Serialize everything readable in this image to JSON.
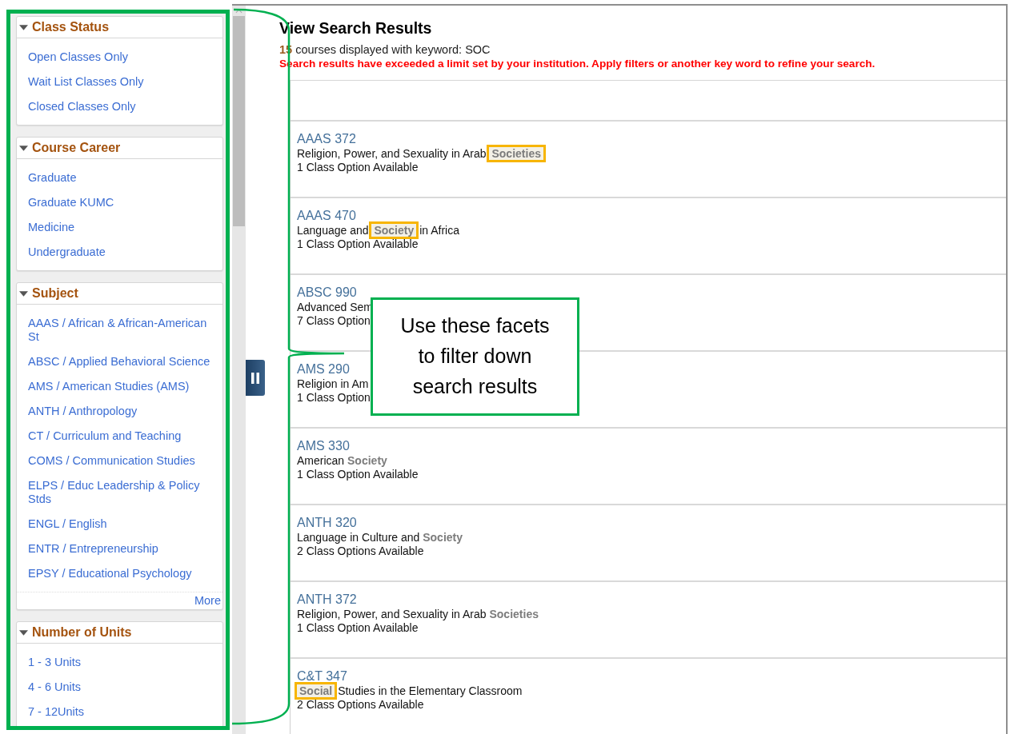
{
  "facet_groups": [
    {
      "title": "Class Status",
      "expanded": true,
      "items": [
        "Open Classes Only",
        "Wait List Classes Only",
        "Closed Classes Only"
      ]
    },
    {
      "title": "Course Career",
      "expanded": true,
      "items": [
        "Graduate",
        "Graduate KUMC",
        "Medicine",
        "Undergraduate"
      ]
    },
    {
      "title": "Subject",
      "expanded": true,
      "items": [
        "AAAS / African & African-American St",
        "ABSC / Applied Behavioral Science",
        "AMS / American Studies (AMS)",
        "ANTH / Anthropology",
        "CT / Curriculum and Teaching",
        "COMS / Communication Studies",
        "ELPS / Educ Leadership & Policy Stds",
        "ENGL / English",
        "ENTR / Entrepreneurship",
        "EPSY / Educational Psychology"
      ],
      "more_link": "More"
    },
    {
      "title": "Number of Units",
      "expanded": true,
      "items": [
        "1 - 3 Units",
        "4 - 6 Units",
        "7 - 12Units"
      ]
    }
  ],
  "results_header": {
    "title": "View Search Results",
    "summary": "**15** courses displayed with keyword: SOC",
    "warning": "Search results have exceeded a limit set by your institution. Apply filters or another key word to refine your search."
  },
  "results": [
    {
      "code": "AAAS 372",
      "description": "Religion, Power, and Sexuality in Arab **Societies**",
      "options": "1 Class Option Available",
      "keyword_highlighted": true
    },
    {
      "code": "AAAS 470",
      "description": "Language and **Society** in Africa",
      "options": "1 Class Option Available",
      "keyword_highlighted": true
    },
    {
      "code": "ABSC 990",
      "description": "Advanced Sem",
      "options": "7 Class Option"
    },
    {
      "code": "AMS 290",
      "description": "Religion in Am",
      "options": "1 Class Option"
    },
    {
      "code": "AMS 330",
      "description": "American **Society**",
      "options": "1 Class Option Available",
      "keyword_highlighted": false
    },
    {
      "code": "ANTH 320",
      "description": "Language in Culture and **Society**",
      "options": "2 Class Options Available",
      "keyword_highlighted": false
    },
    {
      "code": "ANTH 372",
      "description": "Religion, Power, and Sexuality in Arab **Societies**",
      "options": "1 Class Option Available",
      "keyword_highlighted": false
    },
    {
      "code": "C&T 347",
      "description": "**Social** Studies in the Elementary Classroom",
      "options": "2 Class Options Available",
      "keyword_highlighted": true
    }
  ],
  "callout": {
    "text": "Use these facets to filter down search results"
  }
}
